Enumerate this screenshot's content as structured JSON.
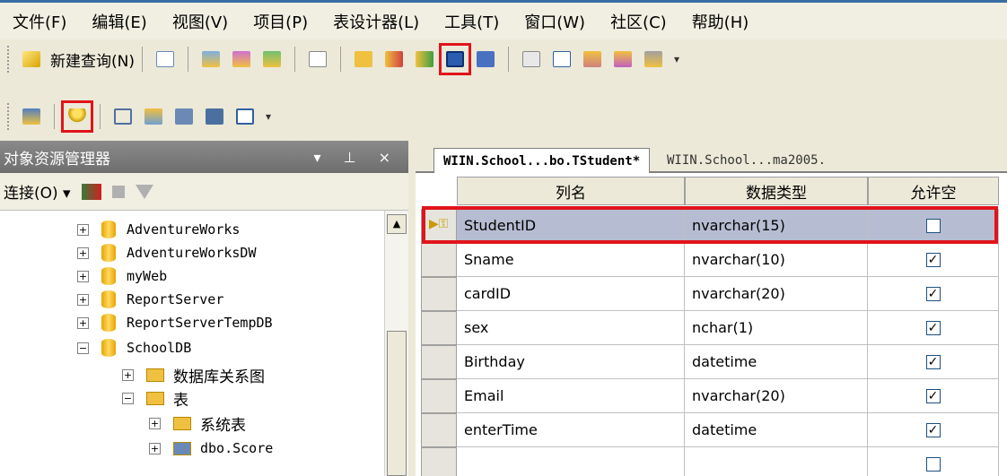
{
  "menu": [
    "文件(F)",
    "编辑(E)",
    "视图(V)",
    "项目(P)",
    "表设计器(L)",
    "工具(T)",
    "窗口(W)",
    "社区(C)",
    "帮助(H)"
  ],
  "toolbar": {
    "new_query_label": "新建查询(N)"
  },
  "object_explorer": {
    "title": "对象资源管理器",
    "title_controls": "▾ ⊥ ×",
    "connect_label": "连接(O) ▾",
    "tree": [
      {
        "label": "AdventureWorks",
        "sign": "+"
      },
      {
        "label": "AdventureWorksDW",
        "sign": "+"
      },
      {
        "label": "myWeb",
        "sign": "+"
      },
      {
        "label": "ReportServer",
        "sign": "+"
      },
      {
        "label": "ReportServerTempDB",
        "sign": "+"
      },
      {
        "label": "SchoolDB",
        "sign": "−"
      },
      {
        "label": "数据库关系图",
        "sign": "+"
      },
      {
        "label": "表",
        "sign": "−"
      },
      {
        "label": "系统表",
        "sign": "+"
      },
      {
        "label": "dbo.Score",
        "sign": "+"
      }
    ]
  },
  "tabs": {
    "active": "WIIN.School...bo.TStudent*",
    "inactive": "WIIN.School...ma2005."
  },
  "grid": {
    "headers": [
      "列名",
      "数据类型",
      "允许空"
    ],
    "rows": [
      {
        "name": "StudentID",
        "type": "nvarchar(15)",
        "nullable": false
      },
      {
        "name": "Sname",
        "type": "nvarchar(10)",
        "nullable": true
      },
      {
        "name": "cardID",
        "type": "nvarchar(20)",
        "nullable": true
      },
      {
        "name": "sex",
        "type": "nchar(1)",
        "nullable": true
      },
      {
        "name": "Birthday",
        "type": "datetime",
        "nullable": true
      },
      {
        "name": "Email",
        "type": "nvarchar(20)",
        "nullable": true
      },
      {
        "name": "enterTime",
        "type": "datetime",
        "nullable": true
      },
      {
        "name": "",
        "type": "",
        "nullable": false
      }
    ]
  },
  "colors": {
    "highlight": "#e1141b",
    "selected_row": "#b6bdd2"
  }
}
